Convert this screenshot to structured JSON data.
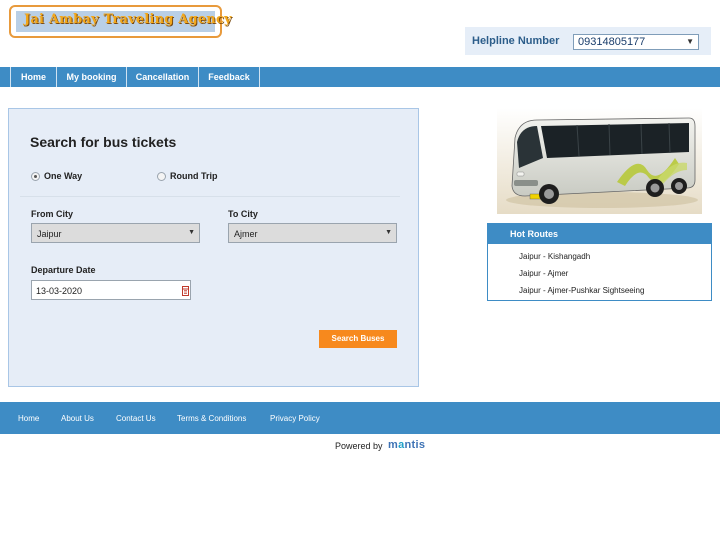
{
  "header": {
    "logo_text": "Jai Ambay Traveling Agency",
    "helpline_label": "Helpline Number",
    "helpline_number": "09314805177"
  },
  "nav": {
    "items": [
      "Home",
      "My booking",
      "Cancellation",
      "Feedback"
    ]
  },
  "search": {
    "title": "Search for bus tickets",
    "trip_types": [
      {
        "label": "One Way",
        "checked": true
      },
      {
        "label": "Round Trip",
        "checked": false
      }
    ],
    "from_label": "From City",
    "from_value": "Jaipur",
    "to_label": "To City",
    "to_value": "Ajmer",
    "date_label": "Departure Date",
    "date_value": "13-03-2020",
    "button_label": "Search Buses"
  },
  "hot_routes": {
    "title": "Hot Routes",
    "routes": [
      "Jaipur - Kishangadh",
      "Jaipur - Ajmer",
      "Jaipur - Ajmer-Pushkar Sightseeing"
    ]
  },
  "footer": {
    "links": [
      "Home",
      "About Us",
      "Contact Us",
      "Terms & Conditions",
      "Privacy Policy"
    ],
    "powered_by": "Powered by",
    "brand_prefix": "m",
    "brand_highlight": "a",
    "brand_suffix": "ntis"
  },
  "colors": {
    "primary_blue": "#3e8cc5",
    "accent_orange": "#f7891d",
    "panel_bg": "#e6edf7"
  }
}
